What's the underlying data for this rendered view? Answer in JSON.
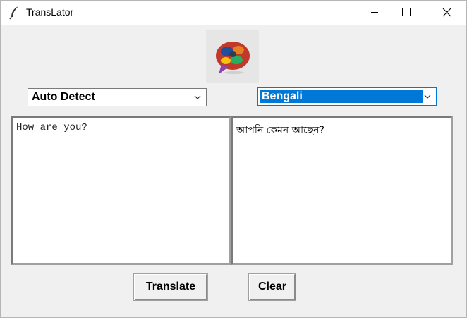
{
  "window": {
    "title": "TransLator"
  },
  "controls": {
    "minimize": "minimize",
    "maximize": "maximize",
    "close": "close"
  },
  "source_language": {
    "selected": "Auto Detect"
  },
  "target_language": {
    "selected": "Bengali"
  },
  "input": {
    "text": "How are you?"
  },
  "output": {
    "text": "আপনি কেমন আছেন?"
  },
  "buttons": {
    "translate": "Translate",
    "clear": "Clear"
  },
  "colors": {
    "selection": "#0078d7",
    "window_bg": "#f0f0f0"
  },
  "icons": {
    "app": "feather-icon",
    "logo": "speech-bubble-flags-logo"
  }
}
